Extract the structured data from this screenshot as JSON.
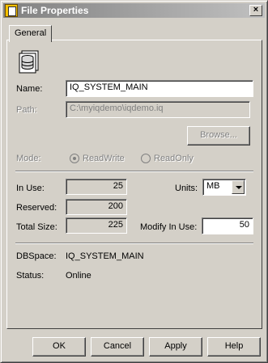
{
  "window": {
    "title": "File Properties"
  },
  "tabs": [
    {
      "label": "General"
    }
  ],
  "fields": {
    "name": {
      "label": "Name:",
      "value": "IQ_SYSTEM_MAIN"
    },
    "path": {
      "label": "Path:",
      "value": "C:\\myiqdemo\\iqdemo.iq"
    }
  },
  "browse_button": "Browse...",
  "mode": {
    "label": "Mode:",
    "options": [
      {
        "label": "ReadWrite",
        "selected": true
      },
      {
        "label": "ReadOnly",
        "selected": false
      }
    ]
  },
  "usage": {
    "in_use": {
      "label": "In Use:",
      "value": "25"
    },
    "reserved": {
      "label": "Reserved:",
      "value": "200"
    },
    "total_size": {
      "label": "Total Size:",
      "value": "225"
    },
    "units": {
      "label": "Units:",
      "value": "MB"
    },
    "modify_in_use": {
      "label": "Modify In Use:",
      "value": "50"
    }
  },
  "info": {
    "dbspace": {
      "label": "DBSpace:",
      "value": "IQ_SYSTEM_MAIN"
    },
    "status": {
      "label": "Status:",
      "value": "Online"
    }
  },
  "buttons": {
    "ok": "OK",
    "cancel": "Cancel",
    "apply": "Apply",
    "help": "Help"
  }
}
